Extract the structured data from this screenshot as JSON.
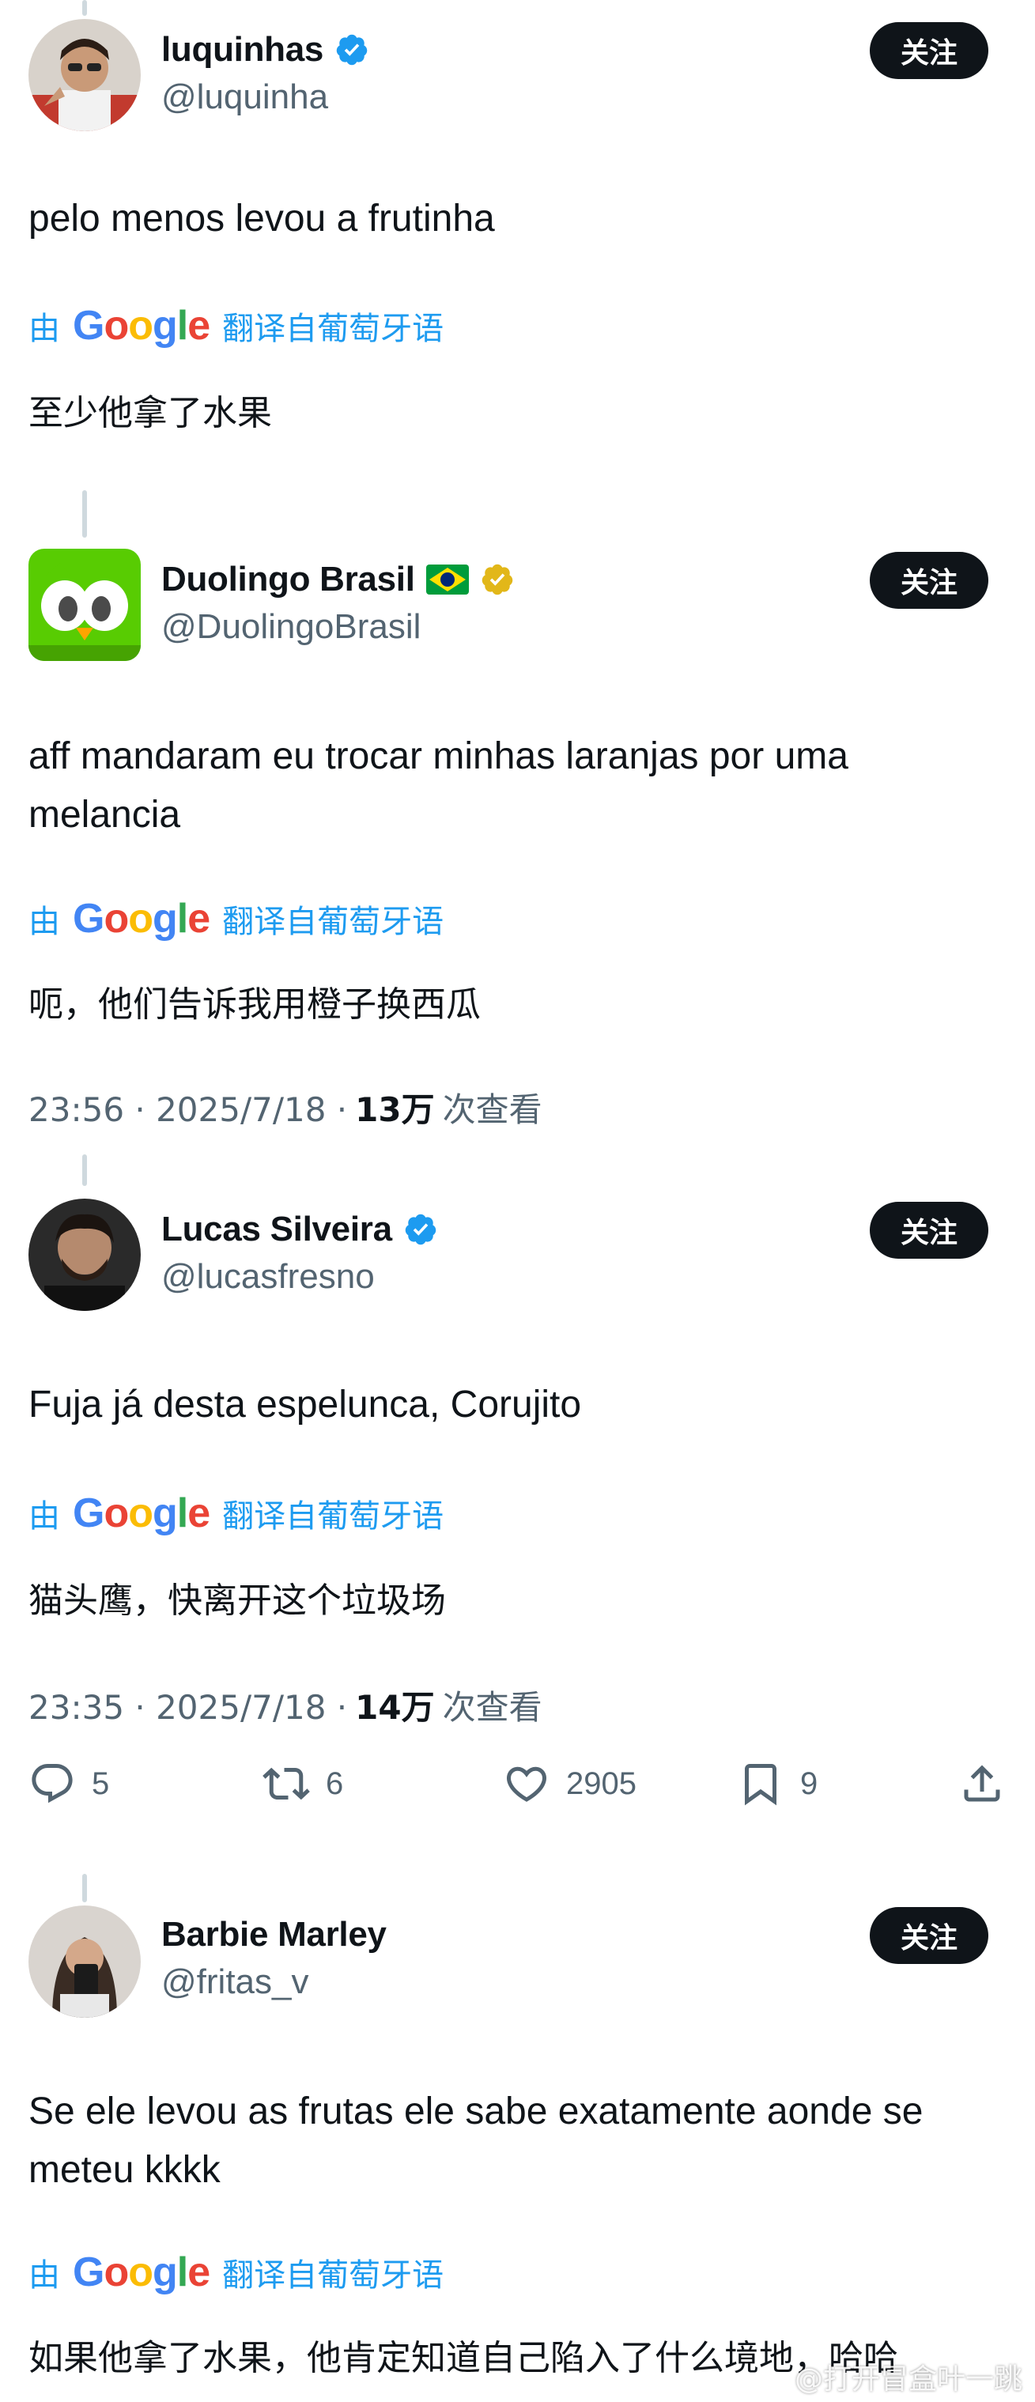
{
  "follow_label": "关注",
  "translate": {
    "prefix": "由",
    "suffix": "翻译自葡萄牙语",
    "google": [
      "G",
      "o",
      "o",
      "g",
      "l",
      "e"
    ]
  },
  "tweets": [
    {
      "display_name": "luquinhas",
      "handle": "@luquinha",
      "verified": "blue",
      "text": "pelo menos levou a frutinha",
      "translated": "至少他拿了水果"
    },
    {
      "display_name": "Duolingo Brasil",
      "handle": "@DuolingoBrasil",
      "verified": "gold",
      "flag": "brazil-flag-icon",
      "text": "aff mandaram eu trocar minhas laranjas por uma melancia",
      "translated": "呃，他们告诉我用橙子换西瓜",
      "time": "23:56 · 2025/7/18 · ",
      "views": "13万",
      "views_label": "次查看"
    },
    {
      "display_name": "Lucas Silveira",
      "handle": "@lucasfresno",
      "verified": "blue",
      "text": "Fuja já desta espelunca, Corujito",
      "translated": "猫头鹰，快离开这个垃圾场",
      "time": "23:35 · 2025/7/18 · ",
      "views": "14万",
      "views_label": "次查看",
      "actions": {
        "replies": "5",
        "reposts": "6",
        "likes": "2905",
        "bookmarks": "9"
      }
    },
    {
      "display_name": "Barbie Marley",
      "handle": "@fritas_v",
      "text": "Se ele levou as frutas ele sabe exatamente aonde se meteu kkkk",
      "translated": "如果他拿了水果，他肯定知道自己陷入了什么境地，哈哈"
    }
  ],
  "watermark": "@打开冒盒叶一跳",
  "colors": {
    "accent": "#1d9bf0",
    "follow_bg": "#0f1419",
    "secondary_text": "#536471",
    "gold_badge": "#e2b719"
  }
}
